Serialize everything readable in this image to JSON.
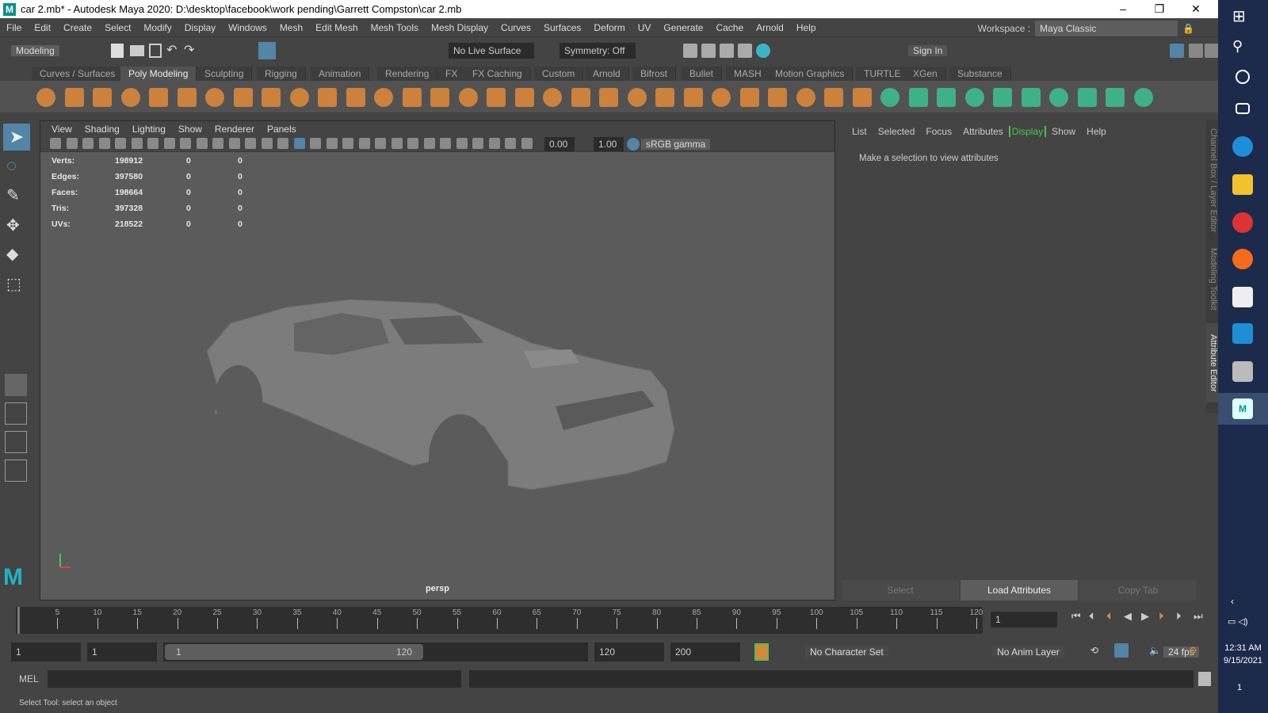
{
  "window": {
    "title": "car 2.mb* - Autodesk Maya 2020: D:\\desktop\\facebook\\work pending\\Garrett Compston\\car 2.mb",
    "app_icon": "M",
    "minimize": "–",
    "restore": "❐",
    "close": "✕"
  },
  "menu": [
    "File",
    "Edit",
    "Create",
    "Select",
    "Modify",
    "Display",
    "Windows",
    "Mesh",
    "Edit Mesh",
    "Mesh Tools",
    "Mesh Display",
    "Curves",
    "Surfaces",
    "Deform",
    "UV",
    "Generate",
    "Cache",
    "Arnold",
    "Help"
  ],
  "workspace": {
    "label": "Workspace :",
    "value": "Maya Classic"
  },
  "statusline": {
    "menuset": "Modeling",
    "live_surface": "No Live Surface",
    "symmetry": "Symmetry: Off",
    "sign_in": "Sign In"
  },
  "shelf_tabs": [
    "Curves / Surfaces",
    "Poly Modeling",
    "Sculpting",
    "Rigging",
    "Animation",
    "Rendering",
    "FX",
    "FX Caching",
    "Custom",
    "Arnold",
    "Bifrost",
    "Bullet",
    "MASH",
    "Motion Graphics",
    "TURTLE",
    "XGen",
    "Substance"
  ],
  "shelf_active": "Poly Modeling",
  "viewport": {
    "menu": [
      "View",
      "Shading",
      "Lighting",
      "Show",
      "Renderer",
      "Panels"
    ],
    "exposure": "0.00",
    "gamma": "1.00",
    "colorspace": "sRGB gamma",
    "hud": [
      {
        "label": "Verts:",
        "a": "198912",
        "b": "0",
        "c": "0"
      },
      {
        "label": "Edges:",
        "a": "397580",
        "b": "0",
        "c": "0"
      },
      {
        "label": "Faces:",
        "a": "198664",
        "b": "0",
        "c": "0"
      },
      {
        "label": "Tris:",
        "a": "397328",
        "b": "0",
        "c": "0"
      },
      {
        "label": "UVs:",
        "a": "218522",
        "b": "0",
        "c": "0"
      }
    ],
    "camera": "persp"
  },
  "attribute_editor": {
    "menu": [
      "List",
      "Selected",
      "Focus",
      "Attributes",
      "Display",
      "Show",
      "Help"
    ],
    "message": "Make a selection to view attributes",
    "buttons": {
      "select": "Select",
      "load": "Load Attributes",
      "copy": "Copy Tab"
    }
  },
  "side_tabs": [
    "Channel Box / Layer Editor",
    "Modeling Toolkit",
    "Attribute Editor"
  ],
  "timeline": {
    "ticks": [
      5,
      10,
      15,
      20,
      25,
      30,
      35,
      40,
      45,
      50,
      55,
      60,
      65,
      70,
      75,
      80,
      85,
      90,
      95,
      100,
      105,
      110,
      115,
      120
    ],
    "current_frame": "1"
  },
  "range": {
    "start": "1",
    "playback_start": "1",
    "slider_start": "1",
    "slider_end": "120",
    "playback_end": "120",
    "end": "200",
    "character_set": "No Character Set",
    "anim_layer": "No Anim Layer",
    "fps": "24 fps"
  },
  "command": {
    "label": "MEL"
  },
  "help_line": "Select Tool: select an object",
  "taskbar": {
    "time": "12:31 AM",
    "date": "9/15/2021",
    "notif": "1"
  },
  "colors": {
    "accent": "#5285a6",
    "shelf_orange": "#d9863a",
    "green": "#4fc04f"
  }
}
